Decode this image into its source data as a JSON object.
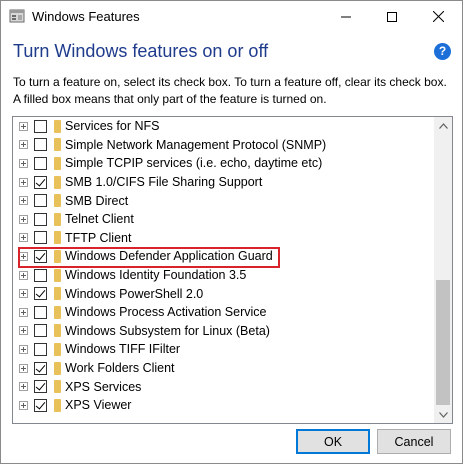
{
  "window": {
    "title": "Windows Features"
  },
  "heading": "Turn Windows features on or off",
  "description": "To turn a feature on, select its check box. To turn a feature off, clear its check box. A filled box means that only part of the feature is turned on.",
  "features": [
    {
      "label": "Services for NFS",
      "checked": false
    },
    {
      "label": "Simple Network Management Protocol (SNMP)",
      "checked": false
    },
    {
      "label": "Simple TCPIP services (i.e. echo, daytime etc)",
      "checked": false
    },
    {
      "label": "SMB 1.0/CIFS File Sharing Support",
      "checked": true
    },
    {
      "label": "SMB Direct",
      "checked": false
    },
    {
      "label": "Telnet Client",
      "checked": false
    },
    {
      "label": "TFTP Client",
      "checked": false
    },
    {
      "label": "Windows Defender Application Guard",
      "checked": true
    },
    {
      "label": "Windows Identity Foundation 3.5",
      "checked": false
    },
    {
      "label": "Windows PowerShell 2.0",
      "checked": true
    },
    {
      "label": "Windows Process Activation Service",
      "checked": false
    },
    {
      "label": "Windows Subsystem for Linux (Beta)",
      "checked": false
    },
    {
      "label": "Windows TIFF IFilter",
      "checked": false
    },
    {
      "label": "Work Folders Client",
      "checked": true
    },
    {
      "label": "XPS Services",
      "checked": true
    },
    {
      "label": "XPS Viewer",
      "checked": true
    }
  ],
  "buttons": {
    "ok": "OK",
    "cancel": "Cancel"
  },
  "help": "?",
  "icons": {
    "app": "windows-features-icon",
    "minimize": "minimize-icon",
    "maximize": "maximize-icon",
    "close": "close-icon",
    "help": "help-icon",
    "folder": "folder-icon",
    "expand": "expand-plus-icon"
  },
  "colors": {
    "heading": "#1e3b8c",
    "help": "#1c6fd8",
    "highlight": "#d9232b",
    "folder": "#e8c15a",
    "ok_border": "#0078d7"
  }
}
